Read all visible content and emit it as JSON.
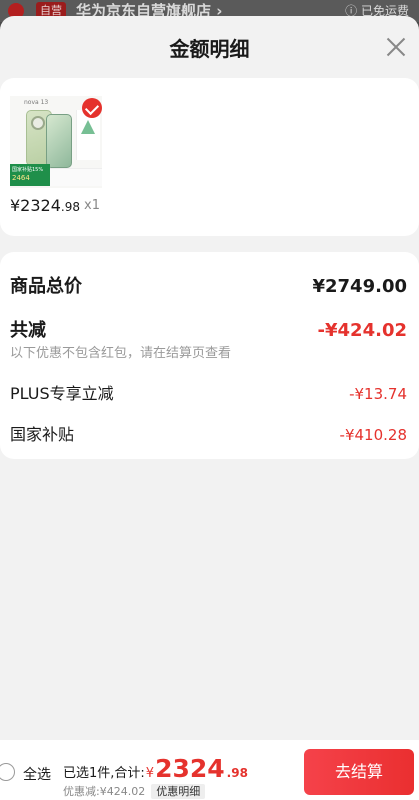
{
  "background": {
    "badge": "自营",
    "shop_name": "华为京东自营旗舰店",
    "shop_arrow": "›",
    "shipping": "ⓘ 已免运费"
  },
  "sheet": {
    "title": "金额明细"
  },
  "product": {
    "brand_mark": "nova 13",
    "subsidy_label": "国家补贴15%",
    "subsidy_amount": "2464",
    "price_main": "¥2324",
    "price_cents": ".98",
    "quantity": "x1"
  },
  "details": {
    "total_label": "商品总价",
    "total_value": "¥2749.00",
    "reduce_label": "共减",
    "reduce_value": "-¥424.02",
    "note": "以下优惠不包含红包，请在结算页查看",
    "items": [
      {
        "label": "PLUS专享立减",
        "value": "-¥13.74"
      },
      {
        "label": "国家补贴",
        "value": "-¥410.28"
      }
    ]
  },
  "bottom": {
    "select_all": "全选",
    "summary_lead": "已选1件,合计:",
    "currency": "¥",
    "amount_main": "2324",
    "amount_cents": ".98",
    "discount_text": "优惠减:¥424.02",
    "discount_detail": "优惠明细",
    "checkout": "去结算"
  },
  "colors": {
    "accent": "#e5322d",
    "sheet_bg": "#f2f2f2",
    "checkout_gradient": [
      "#f5424a",
      "#ea2f30"
    ]
  }
}
